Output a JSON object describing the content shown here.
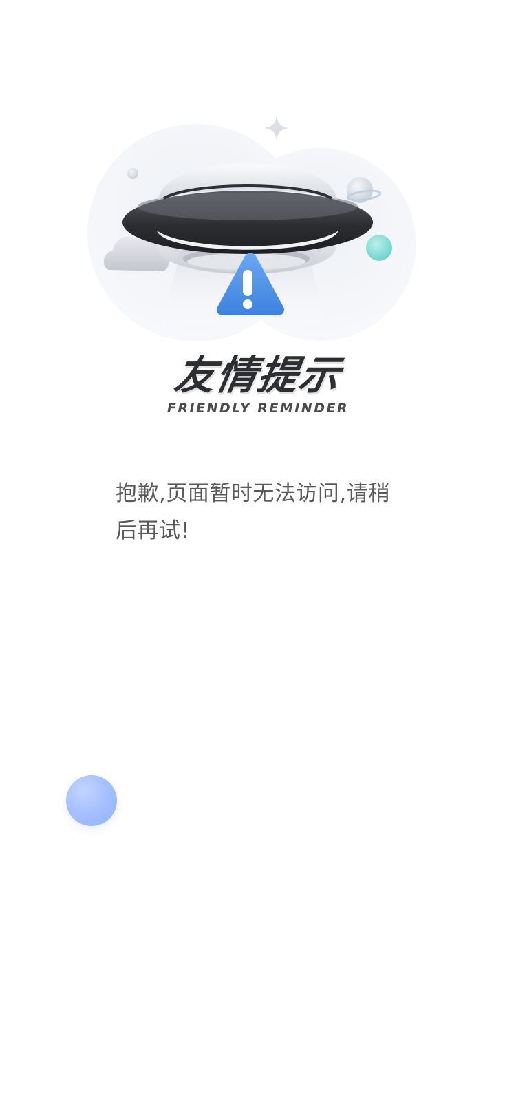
{
  "notice": {
    "title_cn": "友情提示",
    "title_en": "FRIENDLY REMINDER",
    "message": "抱歉,页面暂时无法访问,请稍后再试!"
  },
  "icons": {
    "illustration": "ufo-warning-illustration",
    "warning": "warning-triangle-icon",
    "bubble": "floating-bubble"
  },
  "colors": {
    "background": "#ffffff",
    "warning_blue": "#4a90e2",
    "title": "#2c2e31",
    "message_text": "#5a5a5a",
    "bubble_blue": "#a6c1ff",
    "teal_planet": "#8fe0dc"
  }
}
